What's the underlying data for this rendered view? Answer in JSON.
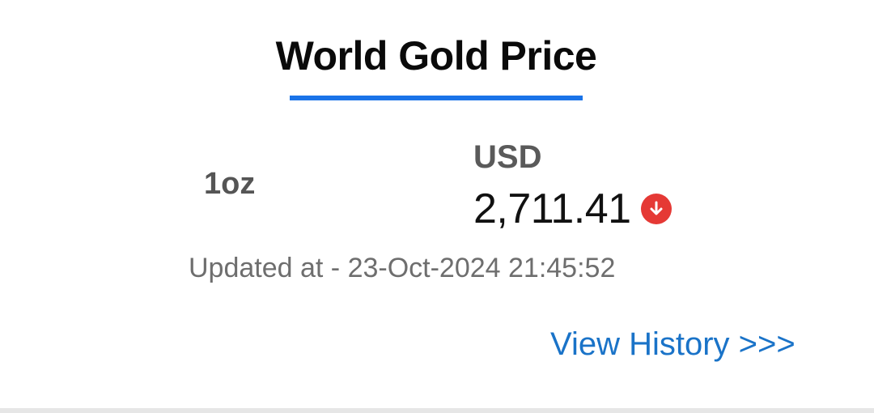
{
  "header": {
    "title": "World Gold Price",
    "accent_color": "#1a73e8"
  },
  "price_panel": {
    "unit": "1oz",
    "currency": "USD",
    "price": "2,711.41",
    "trend_icon": "arrow-down-circle-icon",
    "trend_color": "#e53935"
  },
  "footer": {
    "updated_text": "Updated at - 23-Oct-2024 21:45:52",
    "history_link": "View History >>>"
  }
}
